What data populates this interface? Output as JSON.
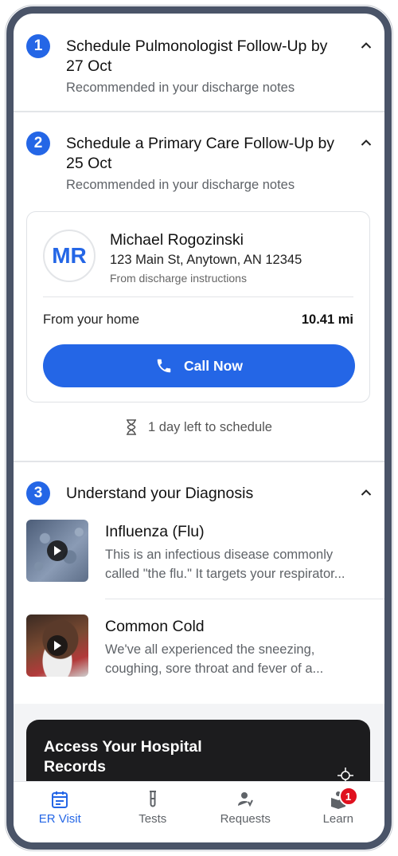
{
  "steps": [
    {
      "number": "1",
      "title": "Schedule Pulmonologist Follow-Up by 27 Oct",
      "subtitle": "Recommended in your discharge notes"
    },
    {
      "number": "2",
      "title": "Schedule a Primary Care Follow-Up by 25 Oct",
      "subtitle": "Recommended in your discharge notes"
    },
    {
      "number": "3",
      "title": "Understand your Diagnosis"
    }
  ],
  "provider": {
    "initials": "MR",
    "name": "Michael Rogozinski",
    "address": "123 Main St, Anytown, AN 12345",
    "source": "From discharge instructions",
    "distance_label": "From your home",
    "distance_value": "10.41 mi",
    "call_label": "Call Now"
  },
  "deadline": "1 day left to schedule",
  "diagnoses": [
    {
      "title": "Influenza (Flu)",
      "desc_line1": "This is an infectious disease commonly",
      "desc_line2": "called \"the flu.\" It targets your respirator..."
    },
    {
      "title": "Common Cold",
      "desc_line1": "We've all experienced the sneezing,",
      "desc_line2": "coughing, sore throat and fever of a..."
    }
  ],
  "promo": {
    "title": "Access Your Hospital Records"
  },
  "tabs": [
    {
      "label": "ER Visit",
      "icon": "calendar-icon",
      "active": true
    },
    {
      "label": "Tests",
      "icon": "test-tube-icon"
    },
    {
      "label": "Requests",
      "icon": "person-requests-icon"
    },
    {
      "label": "Learn",
      "icon": "book-person-icon",
      "badge": "1"
    }
  ],
  "colors": {
    "accent": "#2466e6",
    "badge": "#e0101e",
    "frame": "#4a5468"
  }
}
